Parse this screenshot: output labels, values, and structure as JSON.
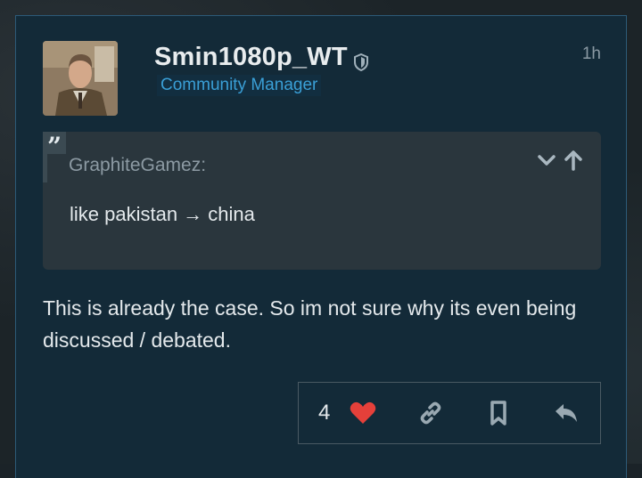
{
  "post": {
    "username": "Smin1080p_WT",
    "user_title": "Community Manager",
    "timestamp": "1h",
    "quote": {
      "author": "GraphiteGamez:",
      "text": "like pakistan → china"
    },
    "body": "This is already the case. So im not sure why its even being discussed / debated.",
    "actions": {
      "like_count": "4"
    }
  },
  "colors": {
    "accent": "#3a9fd6",
    "heart": "#e5403a",
    "post_bg": "#132a38"
  },
  "icons": [
    "shield-icon",
    "quote-icon",
    "chevron-down-icon",
    "arrow-up-icon",
    "heart-icon",
    "link-icon",
    "bookmark-icon",
    "reply-icon"
  ]
}
